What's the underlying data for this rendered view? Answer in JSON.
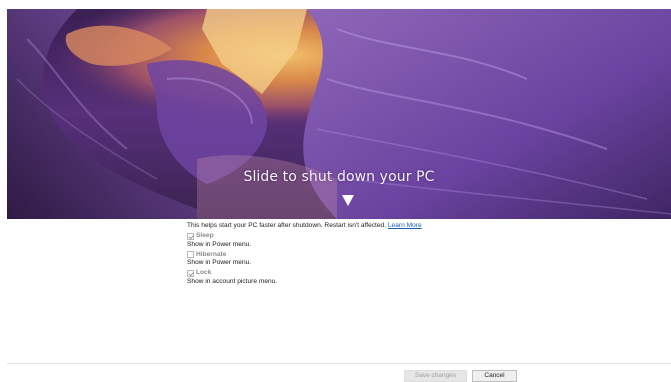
{
  "overlay": {
    "title": "Slide to shut down your PC",
    "arrow_icon": "triangle-down-icon"
  },
  "settings": {
    "fast_startup_info": "This helps start your PC faster after shutdown. Restart isn't affected.",
    "learn_more": "Learn More",
    "options": [
      {
        "label": "Sleep",
        "desc": "Show in Power menu.",
        "checked": true
      },
      {
        "label": "Hibernate",
        "desc": "Show in Power menu.",
        "checked": false
      },
      {
        "label": "Lock",
        "desc": "Show in account picture menu.",
        "checked": true
      }
    ]
  },
  "footer": {
    "save_label": "Save changes",
    "cancel_label": "Cancel"
  },
  "colors": {
    "link": "#1a5fb4",
    "hero_purple": "#4a2a63"
  }
}
